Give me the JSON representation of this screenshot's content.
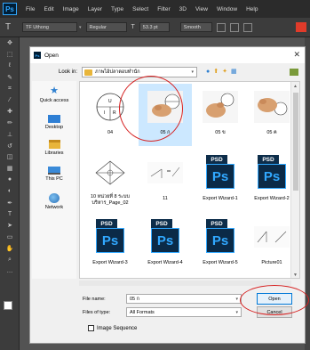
{
  "app": {
    "logo": "Ps",
    "menu": [
      "File",
      "Edit",
      "Image",
      "Layer",
      "Type",
      "Select",
      "Filter",
      "3D",
      "View",
      "Window",
      "Help"
    ]
  },
  "options": {
    "tool_glyph": "T",
    "font_family": "TF Uthong",
    "font_style": "Regular",
    "font_size": "53.3 pt",
    "antialias": "Smooth",
    "accent_color": "#e03b2a"
  },
  "dialog": {
    "title": "Open",
    "look_in_label": "Look in:",
    "look_in_value": "ภาพไอ้ปลาตอบทำนัก",
    "places": [
      "Quick access",
      "Desktop",
      "Libraries",
      "This PC",
      "Network"
    ],
    "files": [
      {
        "name": "04",
        "kind": "drawing",
        "selected": false
      },
      {
        "name": "05 ก",
        "kind": "photo",
        "selected": true
      },
      {
        "name": "05 ข",
        "kind": "photo",
        "selected": false
      },
      {
        "name": "05 ฅ",
        "kind": "photo",
        "selected": false
      },
      {
        "name": "10 หน่วยที่ 8 ระบบ บริหาร_Page_02",
        "kind": "diagram",
        "selected": false
      },
      {
        "name": "11",
        "kind": "diagram",
        "selected": false
      },
      {
        "name": "Export Wizard-1",
        "kind": "psd",
        "selected": false
      },
      {
        "name": "Export Wizard-2",
        "kind": "psd",
        "selected": false
      },
      {
        "name": "Export Wizard-3",
        "kind": "psd",
        "selected": false
      },
      {
        "name": "Export Wizard-4",
        "kind": "psd",
        "selected": false
      },
      {
        "name": "Export Wizard-5",
        "kind": "psd",
        "selected": false
      },
      {
        "name": "Picture01",
        "kind": "diagram",
        "selected": false
      }
    ],
    "psd_tag": "PSD",
    "psd_logo": "Ps",
    "file_name_label": "File name:",
    "file_name_value": "05 ก",
    "file_type_label": "Files of type:",
    "file_type_value": "All Formats",
    "open_button": "Open",
    "cancel_button": "Cancel",
    "image_sequence_label": "Image Sequence",
    "image_sequence_checked": false
  }
}
